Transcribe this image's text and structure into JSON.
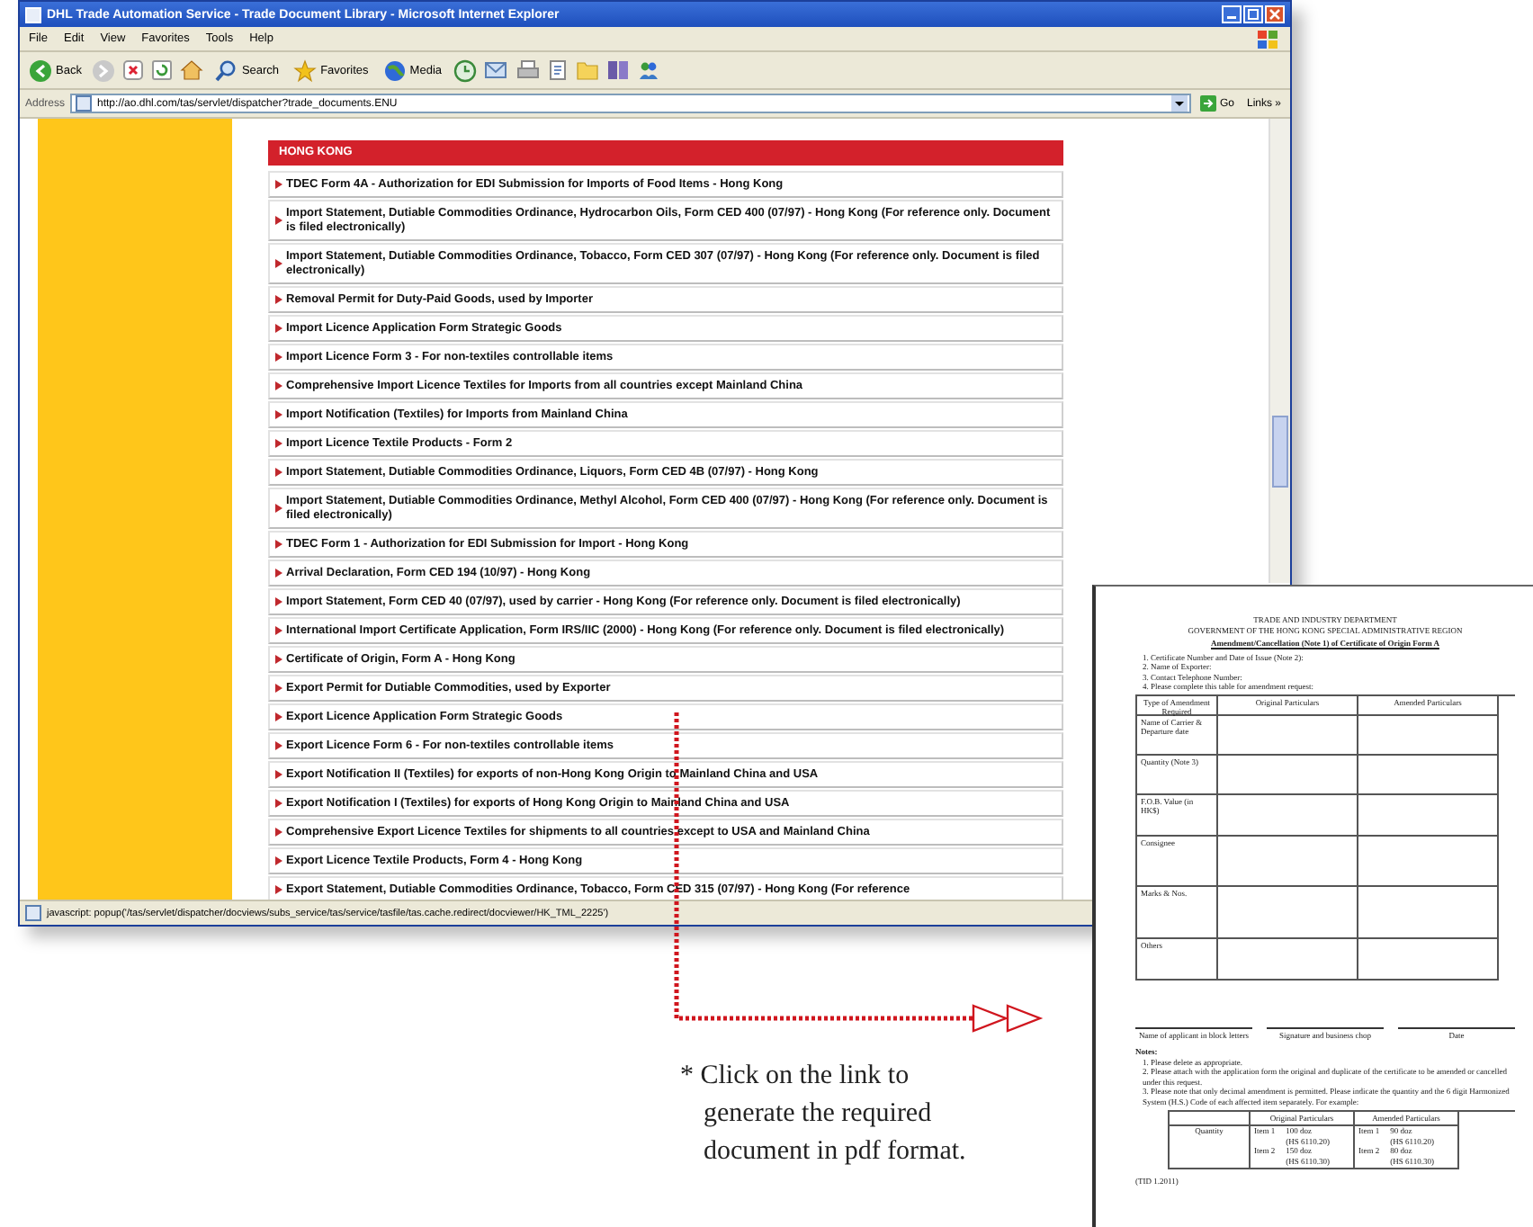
{
  "window": {
    "title": "DHL Trade Automation Service - Trade Document Library - Microsoft Internet Explorer"
  },
  "menu": [
    "File",
    "Edit",
    "View",
    "Favorites",
    "Tools",
    "Help"
  ],
  "toolbar": [
    {
      "kind": "back",
      "label": "Back"
    },
    {
      "kind": "forward"
    },
    {
      "kind": "stop"
    },
    {
      "kind": "refresh"
    },
    {
      "kind": "home"
    },
    {
      "kind": "search",
      "label": "Search"
    },
    {
      "kind": "favorites",
      "label": "Favorites"
    },
    {
      "kind": "media",
      "label": "Media"
    },
    {
      "kind": "history"
    },
    {
      "kind": "mail"
    },
    {
      "kind": "print"
    },
    {
      "kind": "edit"
    },
    {
      "kind": "folder"
    },
    {
      "kind": "discuss"
    },
    {
      "kind": "messenger"
    }
  ],
  "address_bar": {
    "label": "Address",
    "value": "http://ao.dhl.com/tas/servlet/dispatcher?trade_documents.ENU",
    "go": "Go",
    "links": "Links »"
  },
  "section_header": "HONG KONG",
  "documents": [
    {
      "text": "TDEC Form 4A - Authorization for EDI Submission for Imports of Food Items - Hong Kong"
    },
    {
      "text": "Import Statement, Dutiable Commodities Ordinance, Hydrocarbon Oils, Form CED 400 (07/97) - Hong Kong (For reference only. Document is filed electronically)"
    },
    {
      "text": "Import Statement, Dutiable Commodities Ordinance, Tobacco, Form CED 307 (07/97) - Hong Kong (For reference only. Document is filed electronically)"
    },
    {
      "text": "Removal Permit for Duty-Paid Goods, used by Importer"
    },
    {
      "text": "Import Licence Application Form Strategic Goods"
    },
    {
      "text": "Import Licence Form 3 - For non-textiles controllable items"
    },
    {
      "text": "Comprehensive Import Licence Textiles for Imports from all countries except Mainland China"
    },
    {
      "text": "Import Notification (Textiles) for Imports from Mainland China"
    },
    {
      "text": "Import Licence Textile Products - Form 2"
    },
    {
      "text": "Import Statement, Dutiable Commodities Ordinance, Liquors, Form CED 4B (07/97) - Hong Kong"
    },
    {
      "text": "Import Statement, Dutiable Commodities Ordinance, Methyl Alcohol, Form CED 400 (07/97) - Hong Kong (For reference only. Document is filed electronically)"
    },
    {
      "text": "TDEC Form 1 - Authorization for EDI Submission for Import - Hong Kong"
    },
    {
      "text": "Arrival Declaration, Form CED 194 (10/97) - Hong Kong"
    },
    {
      "text": "Import Statement, Form CED 40 (07/97), used by carrier - Hong Kong (For reference only. Document is filed electronically)"
    },
    {
      "text": "International Import Certificate Application, Form IRS/IIC (2000) - Hong Kong (For reference only. Document is filed electronically)"
    },
    {
      "text": "Certificate of Origin, Form A - Hong Kong"
    },
    {
      "text": "Export Permit for Dutiable Commodities, used by Exporter"
    },
    {
      "text": "Export Licence Application Form Strategic Goods"
    },
    {
      "text": "Export Licence Form 6 - For non-textiles controllable items"
    },
    {
      "text": "Export Notification II (Textiles) for exports of non-Hong Kong Origin to Mainland China and USA"
    },
    {
      "text": "Export Notification I (Textiles) for exports of Hong Kong Origin to Mainland China and USA"
    },
    {
      "text": "Comprehensive Export Licence Textiles for shipments to all countries except to USA and Mainland China"
    },
    {
      "text": "Export Licence Textile Products, Form 4 - Hong Kong"
    },
    {
      "text": "Export Statement, Dutiable Commodities Ordinance, Tobacco, Form CED 315 (07/97) - Hong Kong (For reference"
    }
  ],
  "status_bar": "javascript: popup('/tas/servlet/dispatcher/docviews/subs_service/tas/service/tasfile/tas.cache.redirect/docviewer/HK_TML_2225')",
  "document": {
    "heading": [
      "TRADE AND INDUSTRY DEPARTMENT",
      "GOVERNMENT OF THE HONG KONG SPECIAL ADMINISTRATIVE REGION"
    ],
    "title": "Amendment/Cancellation (Note 1) of Certificate of Origin Form A",
    "fields": [
      "1.  Certificate Number and Date of Issue (Note 2):",
      "2.  Name of Exporter:",
      "3.  Contact Telephone Number:",
      "4.  Please complete this table for amendment request:"
    ],
    "table_columns": [
      "Type of Amendment Required",
      "Original Particulars",
      "Amended Particulars"
    ],
    "table_rows": [
      "Name of Carrier & Departure date",
      "Quantity (Note 3)",
      "F.O.B. Value (in HK$)",
      "Consignee",
      "Marks & Nos.",
      "Others"
    ],
    "signatures": [
      "Name of applicant in block letters",
      "Signature and business chop",
      "Date"
    ],
    "notes_title": "Notes:",
    "notes": [
      "1.  Please delete as appropriate.",
      "2.  Please attach with the application form the original and duplicate of the certificate to be amended or cancelled under this request.",
      "3.  Please note that only decimal amendment is permitted.  Please indicate the quantity and the 6 digit Harmonized System (H.S.) Code of each affected item separately.  For example:"
    ],
    "example": {
      "columns": [
        "Original Particulars",
        "Amended Particulars"
      ],
      "label": "Quantity",
      "original": [
        [
          "Item 1",
          "100 doz",
          "(HS 6110.20)"
        ],
        [
          "Item 2",
          "150 doz",
          "(HS 6110.30)"
        ]
      ],
      "amended": [
        [
          "Item 1",
          "90 doz",
          "(HS 6110.20)"
        ],
        [
          "Item 2",
          "80 doz",
          "(HS 6110.30)"
        ]
      ]
    },
    "footer": "(TID 1.2011)"
  },
  "caption": "* Click on the link to generate the required document in pdf format."
}
